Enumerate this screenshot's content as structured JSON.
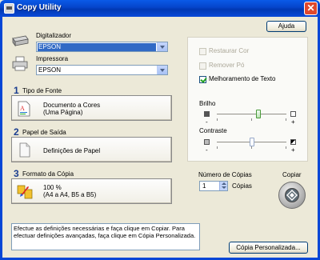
{
  "window": {
    "title": "Copy Utility"
  },
  "header": {
    "help_label": "Ajuda"
  },
  "scanner": {
    "label": "Digitalizador",
    "value": "EPSON"
  },
  "printer": {
    "label": "Impressora",
    "value": "EPSON"
  },
  "source": {
    "number": "1",
    "title": "Tipo de Fonte",
    "line1": "Documento a Cores",
    "line2": "(Uma Página)"
  },
  "paper": {
    "number": "2",
    "title": "Papel de Saída",
    "line1": "Definições de Papel"
  },
  "format": {
    "number": "3",
    "title": "Formato da Cópia",
    "line1": "100 %",
    "line2": "(A4 a A4, B5 a B5)"
  },
  "options": {
    "restore_color": {
      "label": "Restaurar Cor",
      "checked": false,
      "enabled": false
    },
    "remove_dust": {
      "label": "Remover Pó",
      "checked": false,
      "enabled": false
    },
    "text_enhance": {
      "label": "Melhoramento de Texto",
      "checked": true,
      "enabled": true
    }
  },
  "brightness": {
    "label": "Brilho",
    "minus": "-",
    "plus": "+",
    "value": 0.6
  },
  "contrast": {
    "label": "Contraste",
    "minus": "-",
    "plus": "+",
    "value": 0.5
  },
  "copies": {
    "label": "Número de Cópias",
    "value": "1",
    "unit": "Cópias"
  },
  "copy_button": {
    "label": "Copiar"
  },
  "status": {
    "text": "Efectue as definições necessárias e faça clique em Copiar. Para efectuar definições avançadas, faça clique em Cópia Personalizada."
  },
  "custom_copy": {
    "label": "Cópia Personalizada..."
  },
  "colors": {
    "accent": "#316ac5",
    "title_bar": "#0546d6",
    "section_number": "#1a3d8f"
  }
}
